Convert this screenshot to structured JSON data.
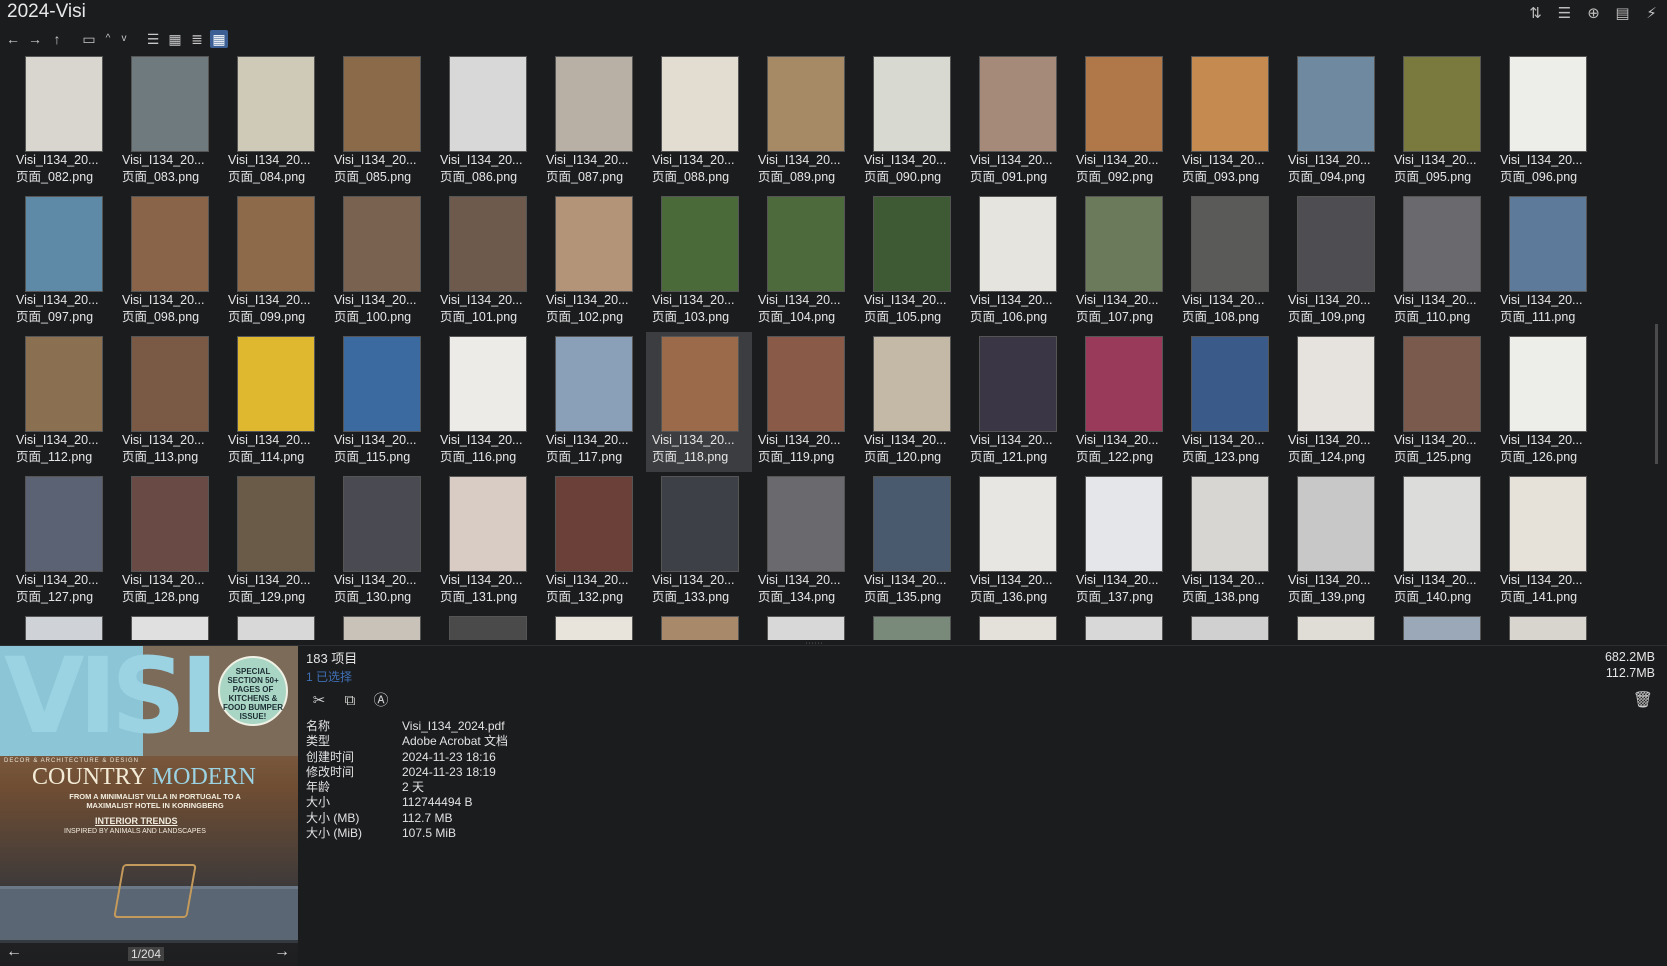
{
  "window": {
    "title": "2024-Visi",
    "top_icons": [
      "sort-icon",
      "list-view-icon",
      "add-icon",
      "clipboard-icon",
      "pin-icon"
    ],
    "top_glyphs": [
      "⇅",
      "☰",
      "⊕",
      "▤",
      "⚡"
    ]
  },
  "toolbar": {
    "back": "←",
    "forward": "→",
    "up": "↑",
    "folder": "▭",
    "caret_up": "^",
    "caret_down": "v",
    "view_details": "☰",
    "view_tiles": "▦",
    "view_list": "≣",
    "view_grid": "▦"
  },
  "files": [
    {
      "line1": "Visi_I134_20...",
      "line2": "页面_082.png",
      "color": "#d9d6d0"
    },
    {
      "line1": "Visi_I134_20...",
      "line2": "页面_083.png",
      "color": "#6f7a7e"
    },
    {
      "line1": "Visi_I134_20...",
      "line2": "页面_084.png",
      "color": "#cfc9b8"
    },
    {
      "line1": "Visi_I134_20...",
      "line2": "页面_085.png",
      "color": "#8a6a48"
    },
    {
      "line1": "Visi_I134_20...",
      "line2": "页面_086.png",
      "color": "#d8d8d8"
    },
    {
      "line1": "Visi_I134_20...",
      "line2": "页面_087.png",
      "color": "#b8b0a4"
    },
    {
      "line1": "Visi_I134_20...",
      "line2": "页面_088.png",
      "color": "#e3dcd0"
    },
    {
      "line1": "Visi_I134_20...",
      "line2": "页面_089.png",
      "color": "#a68a66"
    },
    {
      "line1": "Visi_I134_20...",
      "line2": "页面_090.png",
      "color": "#d8dad2"
    },
    {
      "line1": "Visi_I134_20...",
      "line2": "页面_091.png",
      "color": "#a58a7a"
    },
    {
      "line1": "Visi_I134_20...",
      "line2": "页面_092.png",
      "color": "#b07848"
    },
    {
      "line1": "Visi_I134_20...",
      "line2": "页面_093.png",
      "color": "#c48a50"
    },
    {
      "line1": "Visi_I134_20...",
      "line2": "页面_094.png",
      "color": "#6f8aa0"
    },
    {
      "line1": "Visi_I134_20...",
      "line2": "页面_095.png",
      "color": "#7a7a3e"
    },
    {
      "line1": "Visi_I134_20...",
      "line2": "页面_096.png",
      "color": "#ededea"
    },
    {
      "line1": "Visi_I134_20...",
      "line2": "页面_097.png",
      "color": "#5e8aa8"
    },
    {
      "line1": "Visi_I134_20...",
      "line2": "页面_098.png",
      "color": "#8a6448"
    },
    {
      "line1": "Visi_I134_20...",
      "line2": "页面_099.png",
      "color": "#8c6a4a"
    },
    {
      "line1": "Visi_I134_20...",
      "line2": "页面_100.png",
      "color": "#7a6250"
    },
    {
      "line1": "Visi_I134_20...",
      "line2": "页面_101.png",
      "color": "#6e5a4c"
    },
    {
      "line1": "Visi_I134_20...",
      "line2": "页面_102.png",
      "color": "#b49478"
    },
    {
      "line1": "Visi_I134_20...",
      "line2": "页面_103.png",
      "color": "#4a6a3a"
    },
    {
      "line1": "Visi_I134_20...",
      "line2": "页面_104.png",
      "color": "#4c6a3c"
    },
    {
      "line1": "Visi_I134_20...",
      "line2": "页面_105.png",
      "color": "#3e5a34"
    },
    {
      "line1": "Visi_I134_20...",
      "line2": "页面_106.png",
      "color": "#e6e4df"
    },
    {
      "line1": "Visi_I134_20...",
      "line2": "页面_107.png",
      "color": "#6a7a5a"
    },
    {
      "line1": "Visi_I134_20...",
      "line2": "页面_108.png",
      "color": "#5a5a58"
    },
    {
      "line1": "Visi_I134_20...",
      "line2": "页面_109.png",
      "color": "#4e4e52"
    },
    {
      "line1": "Visi_I134_20...",
      "line2": "页面_110.png",
      "color": "#6a6a6e"
    },
    {
      "line1": "Visi_I134_20...",
      "line2": "页面_111.png",
      "color": "#5e7a9a"
    },
    {
      "line1": "Visi_I134_20...",
      "line2": "页面_112.png",
      "color": "#8a7050"
    },
    {
      "line1": "Visi_I134_20...",
      "line2": "页面_113.png",
      "color": "#7a5a44"
    },
    {
      "line1": "Visi_I134_20...",
      "line2": "页面_114.png",
      "color": "#e0b830"
    },
    {
      "line1": "Visi_I134_20...",
      "line2": "页面_115.png",
      "color": "#3a6aa0"
    },
    {
      "line1": "Visi_I134_20...",
      "line2": "页面_116.png",
      "color": "#ecebe8"
    },
    {
      "line1": "Visi_I134_20...",
      "line2": "页面_117.png",
      "color": "#8aa0b8"
    },
    {
      "line1": "Visi_I134_20...",
      "line2": "页面_118.png",
      "color": "#9a6a4a"
    },
    {
      "line1": "Visi_I134_20...",
      "line2": "页面_119.png",
      "color": "#8a5a48"
    },
    {
      "line1": "Visi_I134_20...",
      "line2": "页面_120.png",
      "color": "#c4b8a6"
    },
    {
      "line1": "Visi_I134_20...",
      "line2": "页面_121.png",
      "color": "#3a3646"
    },
    {
      "line1": "Visi_I134_20...",
      "line2": "页面_122.png",
      "color": "#9a3a5a"
    },
    {
      "line1": "Visi_I134_20...",
      "line2": "页面_123.png",
      "color": "#3a5a8a"
    },
    {
      "line1": "Visi_I134_20...",
      "line2": "页面_124.png",
      "color": "#e6e2de"
    },
    {
      "line1": "Visi_I134_20...",
      "line2": "页面_125.png",
      "color": "#7a5a4c"
    },
    {
      "line1": "Visi_I134_20...",
      "line2": "页面_126.png",
      "color": "#ededea"
    },
    {
      "line1": "Visi_I134_20...",
      "line2": "页面_127.png",
      "color": "#5a6274"
    },
    {
      "line1": "Visi_I134_20...",
      "line2": "页面_128.png",
      "color": "#6a4a44"
    },
    {
      "line1": "Visi_I134_20...",
      "line2": "页面_129.png",
      "color": "#6a5a48"
    },
    {
      "line1": "Visi_I134_20...",
      "line2": "页面_130.png",
      "color": "#4a4a52"
    },
    {
      "line1": "Visi_I134_20...",
      "line2": "页面_131.png",
      "color": "#d8ccc4"
    },
    {
      "line1": "Visi_I134_20...",
      "line2": "页面_132.png",
      "color": "#6a4038"
    },
    {
      "line1": "Visi_I134_20...",
      "line2": "页面_133.png",
      "color": "#3e4048"
    },
    {
      "line1": "Visi_I134_20...",
      "line2": "页面_134.png",
      "color": "#6a6a6e"
    },
    {
      "line1": "Visi_I134_20...",
      "line2": "页面_135.png",
      "color": "#4a5a6e"
    },
    {
      "line1": "Visi_I134_20...",
      "line2": "页面_136.png",
      "color": "#e8e6e2"
    },
    {
      "line1": "Visi_I134_20...",
      "line2": "页面_137.png",
      "color": "#e4e6ea"
    },
    {
      "line1": "Visi_I134_20...",
      "line2": "页面_138.png",
      "color": "#d8d6d2"
    },
    {
      "line1": "Visi_I134_20...",
      "line2": "页面_139.png",
      "color": "#c8c8c8"
    },
    {
      "line1": "Visi_I134_20...",
      "line2": "页面_140.png",
      "color": "#dcdcda"
    },
    {
      "line1": "Visi_I134_20...",
      "line2": "页面_141.png",
      "color": "#e6e2da"
    },
    {
      "line1": "",
      "line2": "",
      "color": "#cfd2d6"
    },
    {
      "line1": "",
      "line2": "",
      "color": "#e0e0e0"
    },
    {
      "line1": "",
      "line2": "",
      "color": "#d8d8d8"
    },
    {
      "line1": "",
      "line2": "",
      "color": "#c8c2b8"
    },
    {
      "line1": "",
      "line2": "",
      "color": "#4a4a4a"
    },
    {
      "line1": "",
      "line2": "",
      "color": "#e8e4dc"
    },
    {
      "line1": "",
      "line2": "",
      "color": "#a88a6a"
    },
    {
      "line1": "",
      "line2": "",
      "color": "#d8d8d8"
    },
    {
      "line1": "",
      "line2": "",
      "color": "#7a8a7a"
    },
    {
      "line1": "",
      "line2": "",
      "color": "#e4e0da"
    },
    {
      "line1": "",
      "line2": "",
      "color": "#d8d8d8"
    },
    {
      "line1": "",
      "line2": "",
      "color": "#d0d0d0"
    },
    {
      "line1": "",
      "line2": "",
      "color": "#e0dcd6"
    },
    {
      "line1": "",
      "line2": "",
      "color": "#9aa8b8"
    },
    {
      "line1": "",
      "line2": "",
      "color": "#d8d4ce"
    }
  ],
  "selected_index": 36,
  "cover": {
    "logo": "VISI",
    "badge": "SPECIAL SECTION 50+ PAGES OF KITCHENS & FOOD BUMPER ISSUE!",
    "tagline": "DECOR & ARCHITECTURE & DESIGN",
    "headline_a": "COUNTRY",
    "headline_b": "MODERN",
    "sub": "FROM A MINIMALIST VILLA IN PORTUGAL TO A MAXIMALIST HOTEL IN KORINGBERG",
    "trends": "INTERIOR TRENDS",
    "trends_sub": "INSPIRED BY ANIMALS AND LANDSCAPES",
    "page_counter": "1/204"
  },
  "details": {
    "item_count": "183 项目",
    "selected": "1 已选择",
    "total_size": "682.2MB",
    "selected_size": "112.7MB",
    "properties": [
      {
        "label": "名称",
        "value": "Visi_I134_2024.pdf"
      },
      {
        "label": "类型",
        "value": "Adobe Acrobat 文档"
      },
      {
        "label": "创建时间",
        "value": "2024-11-23  18:16"
      },
      {
        "label": "修改时间",
        "value": "2024-11-23  18:19"
      },
      {
        "label": "年龄",
        "value": "2 天"
      },
      {
        "label": "大小",
        "value": "112744494 B"
      },
      {
        "label": "大小 (MB)",
        "value": "112.7 MB"
      },
      {
        "label": "大小 (MiB)",
        "value": "107.5 MiB"
      }
    ]
  }
}
